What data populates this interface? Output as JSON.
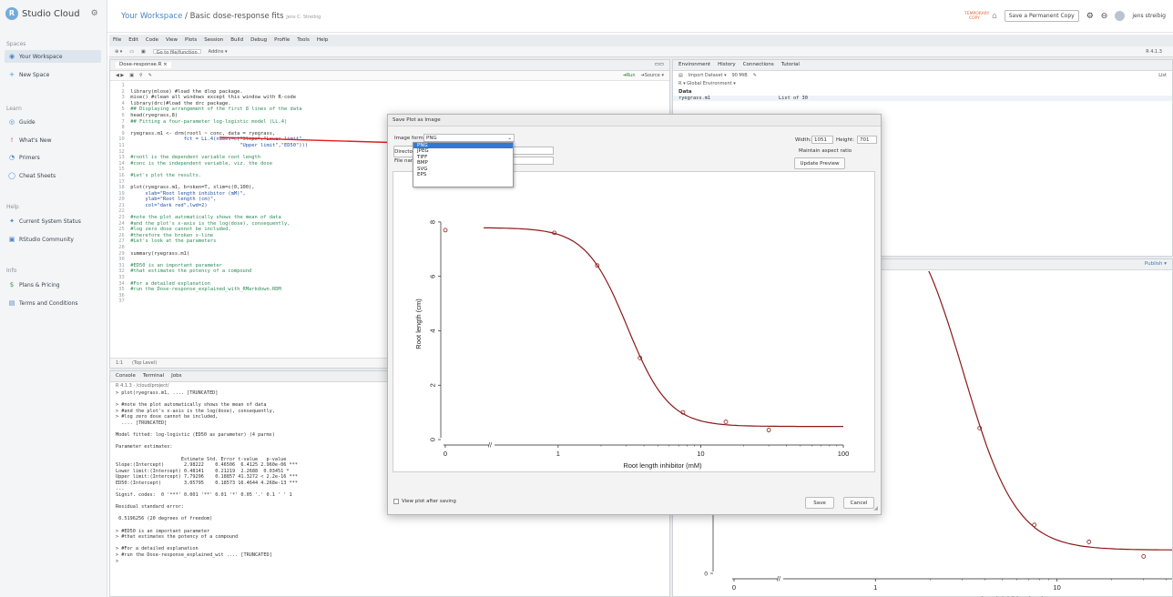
{
  "app": {
    "logo_text": "Studio Cloud",
    "logo_glyph": "R"
  },
  "sidebar": {
    "spaces_heading": "Spaces",
    "your_workspace": "Your Workspace",
    "new_space": "New Space",
    "learn_heading": "Learn",
    "learn_items": [
      "Guide",
      "What's New",
      "Primers",
      "Cheat Sheets"
    ],
    "help_heading": "Help",
    "help_items": [
      "Current System Status",
      "RStudio Community"
    ],
    "info_heading": "Info",
    "info_items": [
      "Plans & Pricing",
      "Terms and Conditions"
    ]
  },
  "topbar": {
    "workspace": "Your Workspace",
    "separator": "/",
    "project": "Basic dose-response fits",
    "owner": "Jens C. Streibig",
    "temporary_badge": "TEMPORARY COPY",
    "save_copy": "Save a Permanent Copy",
    "user": "jens streibig"
  },
  "ide": {
    "menu": [
      "File",
      "Edit",
      "Code",
      "View",
      "Plots",
      "Session",
      "Build",
      "Debug",
      "Profile",
      "Tools",
      "Help"
    ],
    "toolbar_goto": "Go to file/function",
    "toolbar_addins": "Addins",
    "version": "R 4.1.3",
    "editor_tab": "Dose-response.R",
    "run_label": "Run",
    "source_label": "Source",
    "editor_status_pos": "1:1",
    "editor_status_scope": "(Top Level)",
    "env_tabs": [
      "Environment",
      "History",
      "Connections",
      "Tutorial"
    ],
    "env_toolbar": "Import Dataset",
    "env_mem": "90 MiB",
    "env_global": "Global Environment",
    "env_list": "List",
    "env_section": "Data",
    "env_var_name": "ryegrass.m1",
    "env_var_value": "List of 30",
    "plots_publish": "Publish",
    "console_tabs": [
      "Console",
      "Terminal",
      "Jobs"
    ],
    "console_path": "R 4.1.3 · /cloud/project/"
  },
  "code_lines": [
    {
      "n": "1",
      "t": ""
    },
    {
      "n": "2",
      "t": "library(mlose) #load the dlop package."
    },
    {
      "n": "3",
      "t": "mise() #clean all windows except this window with R-code"
    },
    {
      "n": "4",
      "t": "library(drc)#load the drc package."
    },
    {
      "n": "5",
      "t": "## Displaying arrangement of the first 8 lines of the data"
    },
    {
      "n": "6",
      "t": "head(ryegrass,8)"
    },
    {
      "n": "7",
      "t": "## Fitting a four-parameter log-logistic model (LL.4)"
    },
    {
      "n": "8",
      "t": ""
    },
    {
      "n": "9",
      "t": "ryegrass.m1 <- drm(rootl ~ conc, data = ryegrass,"
    },
    {
      "n": "10",
      "t": "                  fct = LL.4(names=c(\"Slope\",\"Lower limit\","
    },
    {
      "n": "11",
      "t": "                                     \"Upper limit\",\"ED50\")))"
    },
    {
      "n": "12",
      "t": ""
    },
    {
      "n": "13",
      "t": "#rootl is the dependent variable root length"
    },
    {
      "n": "14",
      "t": "#conc is the independent variable, viz. the dose"
    },
    {
      "n": "15",
      "t": ""
    },
    {
      "n": "16",
      "t": "#Let's plot the results."
    },
    {
      "n": "17",
      "t": ""
    },
    {
      "n": "18",
      "t": "plot(ryegrass.m1, broken=T, xlim=c(0,100),"
    },
    {
      "n": "19",
      "t": "     xlab=\"Root length inhibitor (mM)\","
    },
    {
      "n": "20",
      "t": "     ylab=\"Root length (cm)\","
    },
    {
      "n": "21",
      "t": "     col=\"dark red\",lwd=2)"
    },
    {
      "n": "22",
      "t": ""
    },
    {
      "n": "23",
      "t": "#note the plot automatically shows the mean of data"
    },
    {
      "n": "24",
      "t": "#and the plot's x-axis is the log(dose), consequently,"
    },
    {
      "n": "25",
      "t": "#log zero dose cannot be included,"
    },
    {
      "n": "26",
      "t": "#therefore the broken x-line"
    },
    {
      "n": "27",
      "t": "#Let's look at the parameters"
    },
    {
      "n": "28",
      "t": ""
    },
    {
      "n": "29",
      "t": "summary(ryegrass.m1)"
    },
    {
      "n": "30",
      "t": ""
    },
    {
      "n": "31",
      "t": "#ED50 is an important parameter"
    },
    {
      "n": "32",
      "t": "#that estimates the potency of a compound"
    },
    {
      "n": "33",
      "t": ""
    },
    {
      "n": "34",
      "t": "#For a detailed explanation"
    },
    {
      "n": "35",
      "t": "#run the Dose-response_explained_with_RMarkdown.RDM"
    },
    {
      "n": "36",
      "t": ""
    },
    {
      "n": "37",
      "t": ""
    }
  ],
  "console_lines": [
    "> plot(ryegrass.m1, .... [TRUNCATED]",
    "",
    "> #note the plot automatically shows the mean of data",
    "> #and the plot's x-axis is the log(dose), consequently,",
    "> #log zero dose cannot be included,",
    "  .... [TRUNCATED]",
    "",
    "Model fitted: log-logistic (ED50 as parameter) (4 parms)",
    "",
    "Parameter estimates:",
    "",
    "                       Estimate Std. Error t-value   p-value",
    "Slope:(Intercept)       2.98222    0.46506  6.4125 2.960e-06 ***",
    "Lower limit:(Intercept) 0.48141    0.21219  2.2688  0.03451 *",
    "Upper limit:(Intercept) 7.79296    0.18857 41.3272 < 2.2e-16 ***",
    "ED50:(Intercept)        3.05795    0.18573 16.4644 4.268e-13 ***",
    "---",
    "Signif. codes:  0 '***' 0.001 '**' 0.01 '*' 0.05 '.' 0.1 ' ' 1",
    "",
    "Residual standard error:",
    "",
    " 0.5196256 (20 degrees of freedom)",
    "",
    "> #ED50 is an important parameter",
    "> #that estimates the potency of a compound",
    "",
    "> #For a detailed explanation",
    "> #run the Dose-response_explained_wit .... [TRUNCATED]",
    ">"
  ],
  "dialog": {
    "title": "Save Plot as Image",
    "format_label": "Image format:",
    "format_value": "PNG",
    "format_options": [
      "PNG",
      "JPEG",
      "TIFF",
      "BMP",
      "SVG",
      "EPS"
    ],
    "directory_btn": "Directory...",
    "filename_label": "File name:",
    "width_label": "Width:",
    "width_value": "1051",
    "height_label": "Height:",
    "height_value": "701",
    "aspect": "Maintain aspect ratio",
    "update": "Update Preview",
    "view_after": "View plot after saving",
    "save": "Save",
    "cancel": "Cancel"
  },
  "chart_data": {
    "type": "line",
    "xlabel": "Root length inhibitor (mM)",
    "ylabel": "Root length (cm)",
    "x_scale": "log (broken axis at 0)",
    "x_ticks": [
      "0",
      "1",
      "10",
      "100"
    ],
    "y_ticks": [
      "0",
      "2",
      "4",
      "6",
      "8"
    ],
    "ylim": [
      0,
      8.5
    ],
    "xlim": [
      0.3,
      100
    ],
    "points": [
      {
        "x": 0,
        "y": 7.7
      },
      {
        "x": 0.94,
        "y": 7.6
      },
      {
        "x": 1.88,
        "y": 6.4
      },
      {
        "x": 3.75,
        "y": 3.0
      },
      {
        "x": 7.5,
        "y": 1.0
      },
      {
        "x": 15,
        "y": 0.65
      },
      {
        "x": 30,
        "y": 0.35
      }
    ],
    "curve": {
      "model": "LL.4",
      "slope": 2.98222,
      "lower": 0.48141,
      "upper": 7.79296,
      "ed50": 3.05795
    },
    "line_color": "#8b1a1a"
  }
}
